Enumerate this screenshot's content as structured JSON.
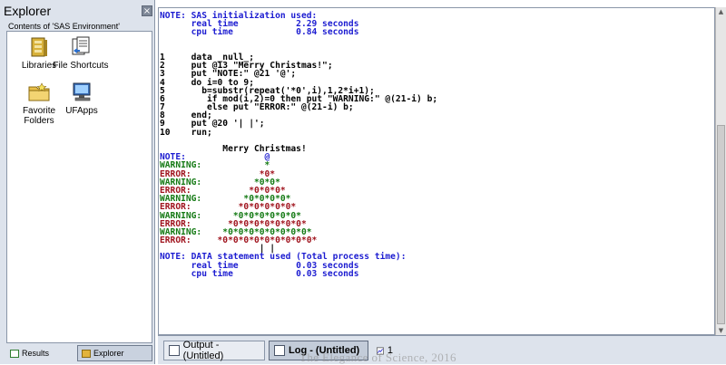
{
  "explorer": {
    "title": "Explorer",
    "close_glyph": "×",
    "subtitle": "Contents of 'SAS Environment'",
    "items": [
      {
        "label": "Libraries",
        "icon": "libraries-icon"
      },
      {
        "label": "File Shortcuts",
        "icon": "file-shortcuts-icon"
      },
      {
        "label": "Favorite Folders",
        "icon": "favorite-folders-icon"
      },
      {
        "label": "UFApps",
        "icon": "ufapps-icon"
      }
    ],
    "tabs": [
      {
        "label": "Results",
        "icon": "results-icon"
      },
      {
        "label": "Explorer",
        "icon": "explorer-icon",
        "active": true
      }
    ]
  },
  "log": {
    "lines": [
      {
        "text": "NOTE: SAS initialization used:",
        "type": "note"
      },
      {
        "text": "      real time           2.29 seconds",
        "type": "note"
      },
      {
        "text": "      cpu time            0.84 seconds",
        "type": "note"
      },
      {
        "text": "",
        "type": "blank"
      },
      {
        "text": "",
        "type": "blank"
      },
      {
        "text": "1     data _null_;",
        "type": "code"
      },
      {
        "text": "2     put @13 \"Merry Christmas!\";",
        "type": "code"
      },
      {
        "text": "3     put \"NOTE:\" @21 '@';",
        "type": "code"
      },
      {
        "text": "4     do i=0 to 9;",
        "type": "code"
      },
      {
        "text": "5       b=substr(repeat('*0',i),1,2*i+1);",
        "type": "code"
      },
      {
        "text": "6        if mod(i,2)=0 then put \"WARNING:\" @(21-i) b;",
        "type": "code"
      },
      {
        "text": "7        else put \"ERROR:\" @(21-i) b;",
        "type": "code"
      },
      {
        "text": "8     end;",
        "type": "code"
      },
      {
        "text": "9     put @20 '| |';",
        "type": "code"
      },
      {
        "text": "10    run;",
        "type": "code"
      },
      {
        "text": "",
        "type": "blank"
      },
      {
        "text": "            Merry Christmas!",
        "type": "code"
      },
      {
        "text": "NOTE:               @",
        "type": "note"
      },
      {
        "text": "WARNING:            *",
        "type": "warn"
      },
      {
        "text": "ERROR:             *0*",
        "type": "err"
      },
      {
        "text": "WARNING:          *0*0*",
        "type": "warn"
      },
      {
        "text": "ERROR:           *0*0*0*",
        "type": "err"
      },
      {
        "text": "WARNING:        *0*0*0*0*",
        "type": "warn"
      },
      {
        "text": "ERROR:         *0*0*0*0*0*",
        "type": "err"
      },
      {
        "text": "WARNING:      *0*0*0*0*0*0*",
        "type": "warn"
      },
      {
        "text": "ERROR:       *0*0*0*0*0*0*0*",
        "type": "err"
      },
      {
        "text": "WARNING:    *0*0*0*0*0*0*0*0*",
        "type": "warn"
      },
      {
        "text": "ERROR:     *0*0*0*0*0*0*0*0*0*",
        "type": "err"
      },
      {
        "text": "                   | |",
        "type": "code"
      },
      {
        "text": "NOTE: DATA statement used (Total process time):",
        "type": "note"
      },
      {
        "text": "      real time           0.03 seconds",
        "type": "note"
      },
      {
        "text": "      cpu time            0.03 seconds",
        "type": "note"
      }
    ]
  },
  "window_tabs": [
    {
      "label": "Output - (Untitled)",
      "icon": "output-window-icon"
    },
    {
      "label": "Log - (Untitled)",
      "icon": "log-window-icon",
      "active": true
    },
    {
      "label": "1",
      "icon": "graph-window-icon"
    }
  ],
  "watermark": "The Elegance of Science, 2016",
  "colors": {
    "note": "#1c1cd1",
    "warning": "#147a14",
    "error": "#a0141e",
    "code": "#000000",
    "panel_bg": "#dde3ec"
  }
}
